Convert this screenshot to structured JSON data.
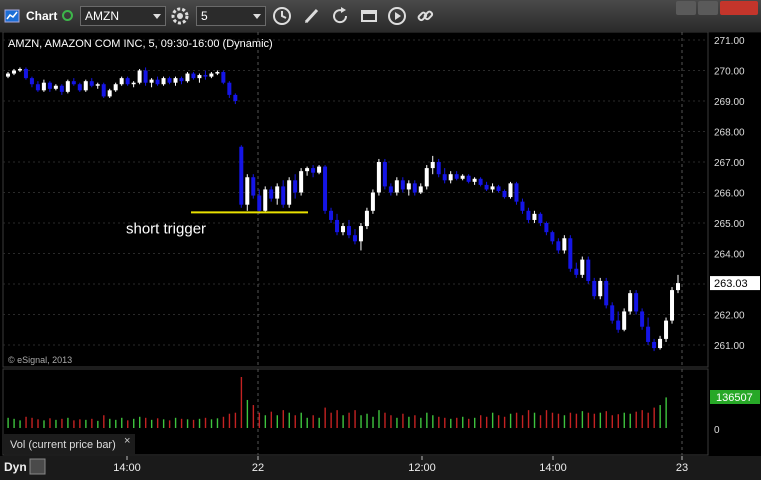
{
  "toolbar": {
    "app_title": "Chart",
    "symbol": "AMZN",
    "interval": "5",
    "icons": [
      "chart-app-icon",
      "settings-gear-icon",
      "clock-icon",
      "pencil-icon",
      "refresh-icon",
      "calendar-icon",
      "play-icon",
      "link-icon"
    ]
  },
  "price_pane": {
    "header": "AMZN, AMAZON COM INC, 5, 09:30-16:00 (Dynamic)",
    "watermark": "© eSignal, 2013",
    "annotation": "short trigger",
    "last_price": "263.03",
    "y_ticks": [
      "271.00",
      "270.00",
      "269.00",
      "268.00",
      "267.00",
      "266.00",
      "265.00",
      "264.00",
      "263.00",
      "262.00",
      "261.00"
    ]
  },
  "volume_pane": {
    "label": "Vol (current price bar)",
    "close_glyph": "×",
    "last_volume": "136507",
    "y_ticks": [
      "0"
    ]
  },
  "x_axis": {
    "labels": [
      "14:00",
      "22",
      "12:00",
      "14:00",
      "23"
    ]
  },
  "footer": {
    "dyn_label": "Dyn"
  },
  "colors": {
    "up": "#ffffff",
    "down": "#1515e6",
    "trigger_line": "#e8e000",
    "vol_up": "#3ec43e",
    "vol_down": "#c42222",
    "last_price_bg": "#ffffff",
    "vol_badge_bg": "#27a827"
  },
  "chart_data": {
    "type": "candlestick",
    "title": "AMZN, AMAZON COM INC, 5, 09:30-16:00 (Dynamic)",
    "ylim": [
      260.6,
      271.2
    ],
    "session_breaks": [
      "22",
      "23"
    ],
    "annotation": {
      "text": "short trigger",
      "price": 265.35
    },
    "last_price": 263.03,
    "candles": [
      [
        269.8,
        269.95,
        269.75,
        269.9
      ],
      [
        269.9,
        270.05,
        269.85,
        270.0
      ],
      [
        270.0,
        270.1,
        269.95,
        270.05
      ],
      [
        270.05,
        270.1,
        269.7,
        269.75
      ],
      [
        269.75,
        269.8,
        269.45,
        269.55
      ],
      [
        269.55,
        269.65,
        269.3,
        269.35
      ],
      [
        269.35,
        269.7,
        269.3,
        269.6
      ],
      [
        269.6,
        269.65,
        269.3,
        269.4
      ],
      [
        269.4,
        269.55,
        269.35,
        269.5
      ],
      [
        269.5,
        269.55,
        269.2,
        269.3
      ],
      [
        269.3,
        269.7,
        269.25,
        269.65
      ],
      [
        269.65,
        269.75,
        269.5,
        269.55
      ],
      [
        269.55,
        269.6,
        269.3,
        269.35
      ],
      [
        269.35,
        269.7,
        269.3,
        269.65
      ],
      [
        269.65,
        269.75,
        269.45,
        269.5
      ],
      [
        269.5,
        269.6,
        269.4,
        269.55
      ],
      [
        269.55,
        269.6,
        269.1,
        269.15
      ],
      [
        269.15,
        269.4,
        269.1,
        269.35
      ],
      [
        269.35,
        269.6,
        269.3,
        269.55
      ],
      [
        269.55,
        269.8,
        269.5,
        269.75
      ],
      [
        269.75,
        269.8,
        269.5,
        269.55
      ],
      [
        269.55,
        269.65,
        269.45,
        269.6
      ],
      [
        269.6,
        270.05,
        269.55,
        270.0
      ],
      [
        270.0,
        270.1,
        269.5,
        269.6
      ],
      [
        269.6,
        269.75,
        269.45,
        269.7
      ],
      [
        269.7,
        269.8,
        269.5,
        269.55
      ],
      [
        269.55,
        269.8,
        269.5,
        269.75
      ],
      [
        269.75,
        269.8,
        269.55,
        269.6
      ],
      [
        269.6,
        269.8,
        269.5,
        269.75
      ],
      [
        269.75,
        269.8,
        269.55,
        269.65
      ],
      [
        269.65,
        269.95,
        269.6,
        269.9
      ],
      [
        269.9,
        269.95,
        269.7,
        269.75
      ],
      [
        269.75,
        269.9,
        269.6,
        269.85
      ],
      [
        269.85,
        270.0,
        269.7,
        269.8
      ],
      [
        269.8,
        269.95,
        269.75,
        269.9
      ],
      [
        269.9,
        270.0,
        269.85,
        269.95
      ],
      [
        269.95,
        270.0,
        269.55,
        269.6
      ],
      [
        269.6,
        269.65,
        269.1,
        269.2
      ],
      [
        269.2,
        269.25,
        268.9,
        269.0
      ],
      [
        267.5,
        267.55,
        265.5,
        265.6
      ],
      [
        265.6,
        266.6,
        265.4,
        266.5
      ],
      [
        266.5,
        266.6,
        265.8,
        265.9
      ],
      [
        265.9,
        266.1,
        265.3,
        265.4
      ],
      [
        265.4,
        266.2,
        265.35,
        266.1
      ],
      [
        266.1,
        266.2,
        265.7,
        265.8
      ],
      [
        265.8,
        266.3,
        265.6,
        266.2
      ],
      [
        266.2,
        266.4,
        265.5,
        265.6
      ],
      [
        265.6,
        266.5,
        265.5,
        266.4
      ],
      [
        266.4,
        266.6,
        265.8,
        266.0
      ],
      [
        266.0,
        266.8,
        265.9,
        266.7
      ],
      [
        266.7,
        266.85,
        266.55,
        266.8
      ],
      [
        266.8,
        266.9,
        266.5,
        266.65
      ],
      [
        266.65,
        266.9,
        266.6,
        266.85
      ],
      [
        266.85,
        266.9,
        265.3,
        265.4
      ],
      [
        265.4,
        265.5,
        265.0,
        265.1
      ],
      [
        265.1,
        265.3,
        264.6,
        264.7
      ],
      [
        264.7,
        265.0,
        264.6,
        264.9
      ],
      [
        264.9,
        265.1,
        264.5,
        264.6
      ],
      [
        264.6,
        264.8,
        264.3,
        264.4
      ],
      [
        264.4,
        265.0,
        264.1,
        264.9
      ],
      [
        264.9,
        265.5,
        264.8,
        265.4
      ],
      [
        265.4,
        266.1,
        265.3,
        266.0
      ],
      [
        266.0,
        267.1,
        265.9,
        267.0
      ],
      [
        267.0,
        267.1,
        266.1,
        266.2
      ],
      [
        266.2,
        266.3,
        265.9,
        266.0
      ],
      [
        266.0,
        266.5,
        265.9,
        266.4
      ],
      [
        266.4,
        266.5,
        266.0,
        266.1
      ],
      [
        266.1,
        266.4,
        265.9,
        266.3
      ],
      [
        266.3,
        266.4,
        265.9,
        266.0
      ],
      [
        266.0,
        266.3,
        265.95,
        266.2
      ],
      [
        266.2,
        266.9,
        266.1,
        266.8
      ],
      [
        266.8,
        267.2,
        266.6,
        267.0
      ],
      [
        267.0,
        267.1,
        266.5,
        266.6
      ],
      [
        266.6,
        266.8,
        266.3,
        266.4
      ],
      [
        266.4,
        266.7,
        266.3,
        266.6
      ],
      [
        266.6,
        266.7,
        266.4,
        266.45
      ],
      [
        266.45,
        266.6,
        266.4,
        266.55
      ],
      [
        266.55,
        266.6,
        266.3,
        266.35
      ],
      [
        266.35,
        266.5,
        266.25,
        266.45
      ],
      [
        266.45,
        266.5,
        266.2,
        266.25
      ],
      [
        266.25,
        266.35,
        266.05,
        266.1
      ],
      [
        266.1,
        266.3,
        266.0,
        266.2
      ],
      [
        266.2,
        266.25,
        266.0,
        266.05
      ],
      [
        266.05,
        266.1,
        265.8,
        265.85
      ],
      [
        265.85,
        266.35,
        265.8,
        266.3
      ],
      [
        266.3,
        266.35,
        265.6,
        265.7
      ],
      [
        265.7,
        265.8,
        265.3,
        265.4
      ],
      [
        265.4,
        265.5,
        265.0,
        265.1
      ],
      [
        265.1,
        265.4,
        265.0,
        265.3
      ],
      [
        265.3,
        265.35,
        264.9,
        265.0
      ],
      [
        265.0,
        265.05,
        264.6,
        264.7
      ],
      [
        264.7,
        264.75,
        264.3,
        264.4
      ],
      [
        264.4,
        264.5,
        264.0,
        264.1
      ],
      [
        264.1,
        264.6,
        264.0,
        264.5
      ],
      [
        264.5,
        264.6,
        263.4,
        263.5
      ],
      [
        263.5,
        263.7,
        263.2,
        263.3
      ],
      [
        263.3,
        263.9,
        263.2,
        263.8
      ],
      [
        263.8,
        263.9,
        263.0,
        263.1
      ],
      [
        263.1,
        263.2,
        262.5,
        262.6
      ],
      [
        262.6,
        263.2,
        262.5,
        263.1
      ],
      [
        263.1,
        263.2,
        262.2,
        262.3
      ],
      [
        262.3,
        262.4,
        261.7,
        261.8
      ],
      [
        261.8,
        262.1,
        261.4,
        261.5
      ],
      [
        261.5,
        262.2,
        261.45,
        262.1
      ],
      [
        262.1,
        262.8,
        262.0,
        262.7
      ],
      [
        262.7,
        262.8,
        262.0,
        262.1
      ],
      [
        262.1,
        262.2,
        261.5,
        261.6
      ],
      [
        261.6,
        261.9,
        261.0,
        261.1
      ],
      [
        261.1,
        261.2,
        260.8,
        260.9
      ],
      [
        260.9,
        261.3,
        260.85,
        261.2
      ],
      [
        261.2,
        261.9,
        261.1,
        261.8
      ],
      [
        261.8,
        262.9,
        261.7,
        262.8
      ],
      [
        262.8,
        263.3,
        262.7,
        263.03
      ]
    ],
    "volume": [
      0.2,
      0.18,
      0.15,
      0.22,
      0.2,
      0.17,
      0.15,
      0.19,
      0.16,
      0.18,
      0.2,
      0.15,
      0.17,
      0.16,
      0.18,
      0.14,
      0.25,
      0.18,
      0.16,
      0.2,
      0.15,
      0.18,
      0.22,
      0.2,
      0.16,
      0.19,
      0.17,
      0.15,
      0.2,
      0.18,
      0.17,
      0.16,
      0.18,
      0.2,
      0.17,
      0.19,
      0.22,
      0.28,
      0.3,
      1.0,
      0.55,
      0.45,
      0.3,
      0.25,
      0.32,
      0.25,
      0.35,
      0.3,
      0.25,
      0.3,
      0.2,
      0.25,
      0.2,
      0.4,
      0.3,
      0.35,
      0.25,
      0.3,
      0.35,
      0.25,
      0.28,
      0.22,
      0.35,
      0.3,
      0.25,
      0.2,
      0.28,
      0.22,
      0.25,
      0.2,
      0.3,
      0.25,
      0.22,
      0.2,
      0.18,
      0.2,
      0.22,
      0.18,
      0.2,
      0.25,
      0.22,
      0.3,
      0.25,
      0.22,
      0.28,
      0.3,
      0.25,
      0.35,
      0.3,
      0.25,
      0.35,
      0.3,
      0.28,
      0.25,
      0.3,
      0.28,
      0.33,
      0.3,
      0.28,
      0.3,
      0.33,
      0.25,
      0.27,
      0.3,
      0.28,
      0.32,
      0.35,
      0.3,
      0.4,
      0.45,
      0.6
    ]
  }
}
